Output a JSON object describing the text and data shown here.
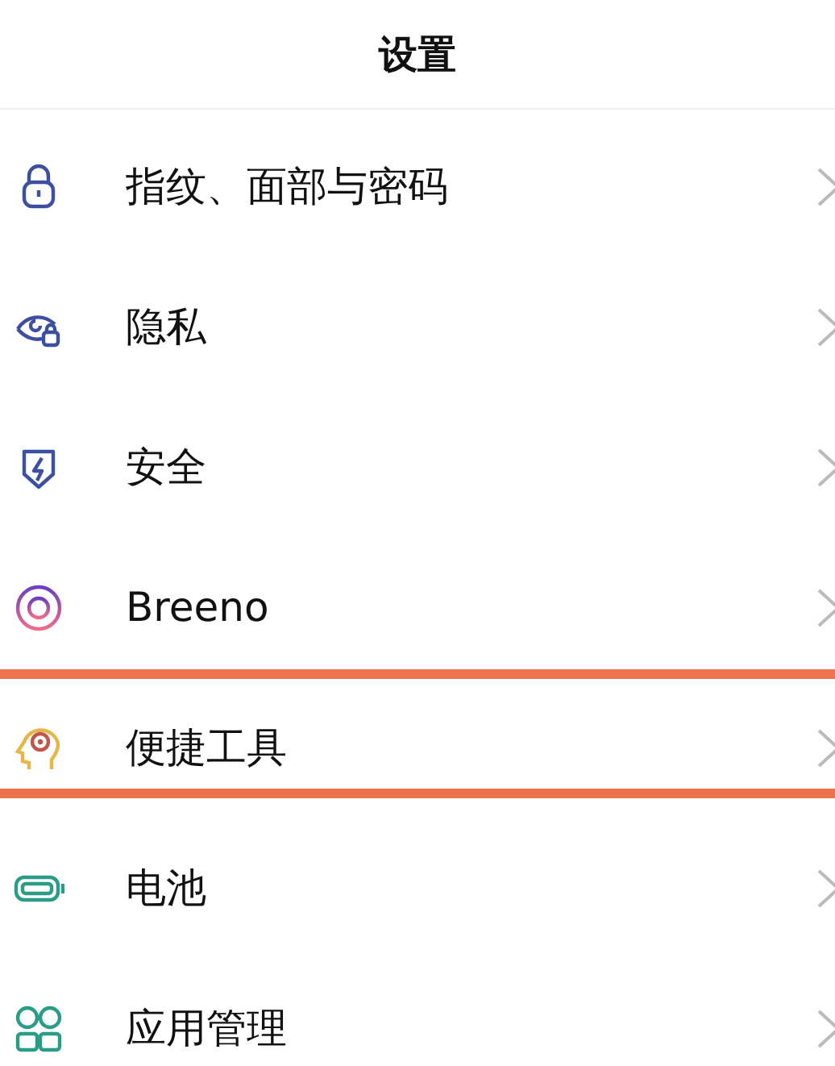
{
  "header": {
    "title": "设置"
  },
  "items": [
    {
      "label": "指纹、面部与密码",
      "highlighted": false
    },
    {
      "label": "隐私",
      "highlighted": false
    },
    {
      "label": "安全",
      "highlighted": false
    },
    {
      "label": "Breeno",
      "highlighted": false
    },
    {
      "label": "便捷工具",
      "highlighted": true
    },
    {
      "label": "电池",
      "highlighted": false
    },
    {
      "label": "应用管理",
      "highlighted": false
    }
  ]
}
